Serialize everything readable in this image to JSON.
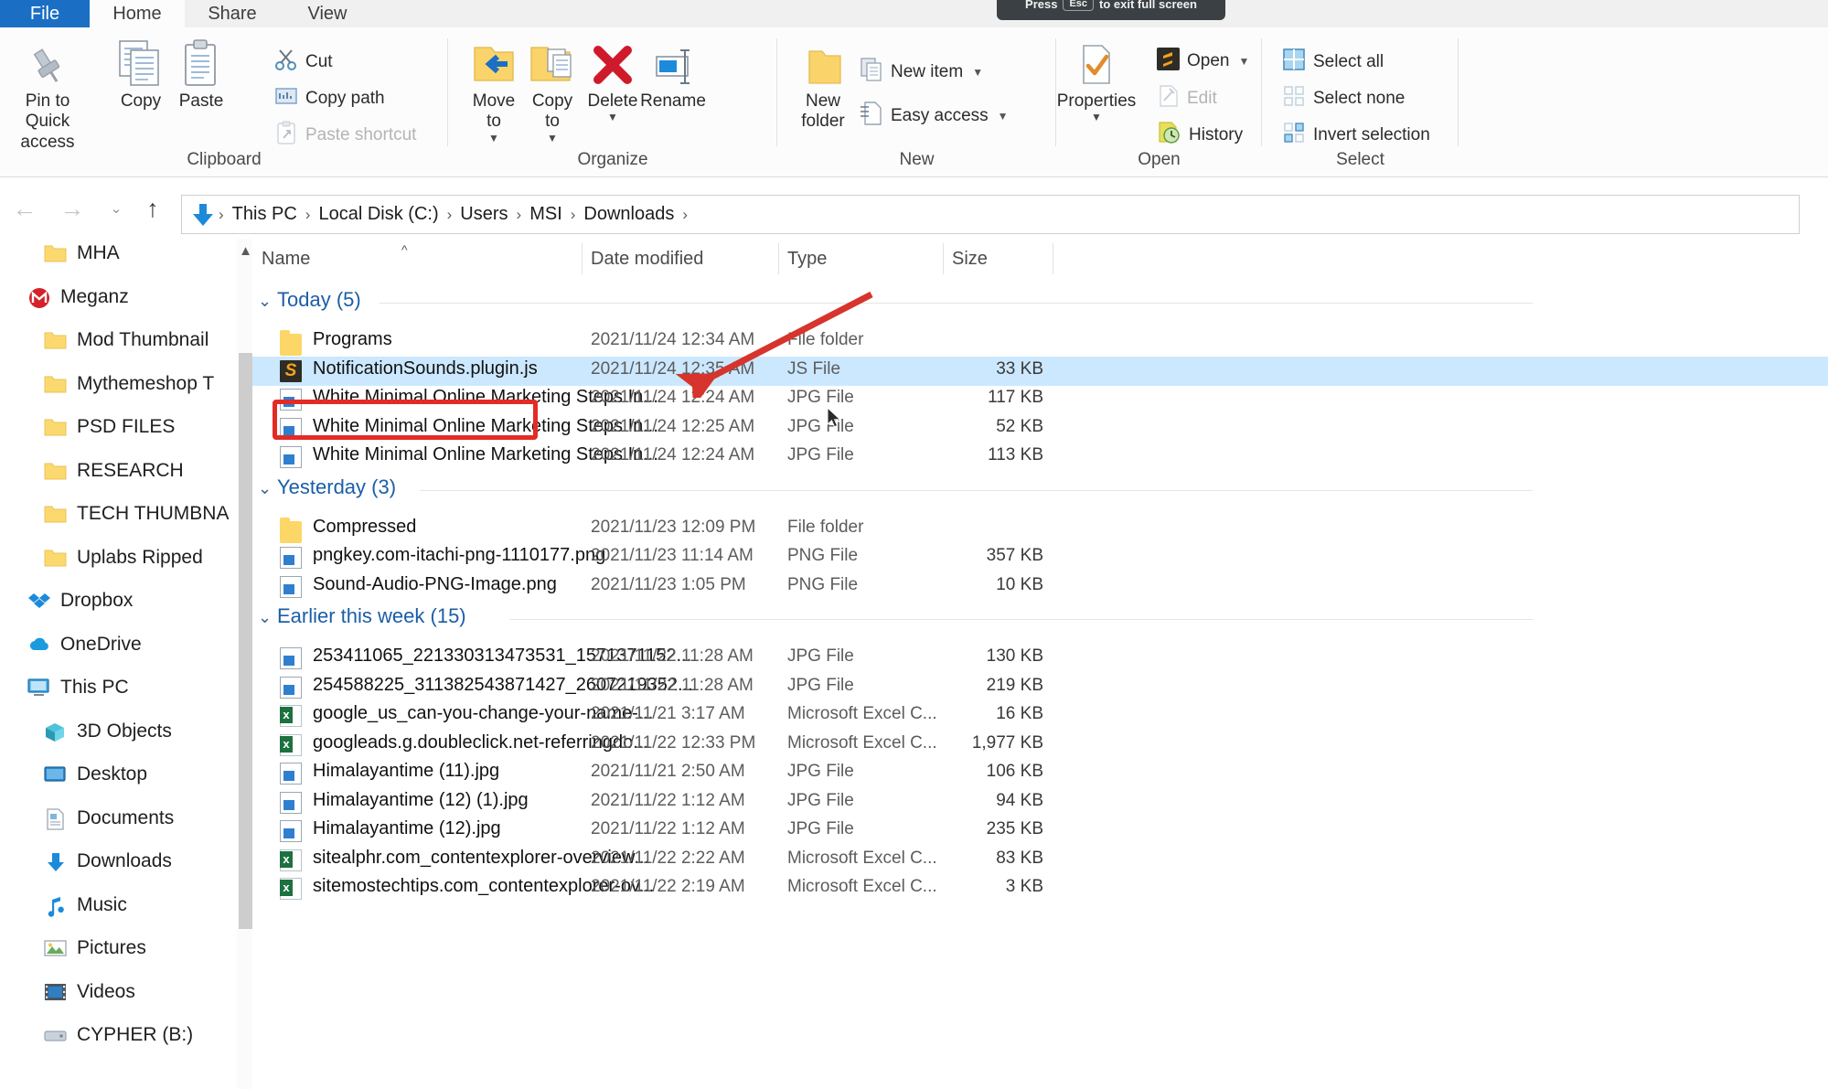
{
  "overlay": {
    "toast_prefix": "Press",
    "toast_key": "Esc",
    "toast_suffix": "to exit full screen"
  },
  "ribbon": {
    "tabs": [
      {
        "id": "file",
        "label": "File"
      },
      {
        "id": "home",
        "label": "Home"
      },
      {
        "id": "share",
        "label": "Share"
      },
      {
        "id": "view",
        "label": "View"
      }
    ],
    "groups": [
      {
        "id": "clipboard",
        "label": "Clipboard"
      },
      {
        "id": "organize",
        "label": "Organize"
      },
      {
        "id": "new",
        "label": "New"
      },
      {
        "id": "open",
        "label": "Open"
      },
      {
        "id": "select",
        "label": "Select"
      }
    ],
    "clipboard": {
      "pin_label": "Pin to Quick\naccess",
      "copy_label": "Copy",
      "paste_label": "Paste",
      "cut_label": "Cut",
      "copy_path_label": "Copy path",
      "paste_shortcut_label": "Paste shortcut"
    },
    "organize": {
      "move_to_label": "Move\nto",
      "copy_to_label": "Copy\nto",
      "delete_label": "Delete",
      "rename_label": "Rename"
    },
    "new_group": {
      "new_folder_label": "New\nfolder",
      "new_item_label": "New item",
      "easy_access_label": "Easy access"
    },
    "open_group": {
      "properties_label": "Properties",
      "open_label": "Open",
      "edit_label": "Edit",
      "history_label": "History"
    },
    "select_group": {
      "select_all_label": "Select all",
      "select_none_label": "Select none",
      "invert_selection_label": "Invert selection"
    }
  },
  "address": {
    "back_glyph": "←",
    "forward_glyph": "→",
    "history_glyph": "⌄",
    "up_glyph": "↑",
    "separator": "›",
    "crumbs": [
      "This PC",
      "Local Disk (C:)",
      "Users",
      "MSI",
      "Downloads"
    ]
  },
  "sidebar": {
    "items": [
      {
        "label": "MHA",
        "icon": "folder-icon",
        "indent": 1
      },
      {
        "label": "Meganz",
        "icon": "mega-icon",
        "indent": 0
      },
      {
        "label": "Mod Thumbnail",
        "icon": "folder-icon",
        "indent": 1
      },
      {
        "label": "Mythemeshop T",
        "icon": "folder-icon",
        "indent": 1
      },
      {
        "label": "PSD FILES",
        "icon": "folder-icon",
        "indent": 1
      },
      {
        "label": "RESEARCH",
        "icon": "folder-icon",
        "indent": 1
      },
      {
        "label": "TECH THUMBNA",
        "icon": "folder-icon",
        "indent": 1
      },
      {
        "label": "Uplabs Ripped",
        "icon": "folder-icon",
        "indent": 1
      },
      {
        "label": "Dropbox",
        "icon": "dropbox-icon",
        "indent": 0
      },
      {
        "label": "OneDrive",
        "icon": "onedrive-icon",
        "indent": 0
      },
      {
        "label": "This PC",
        "icon": "monitor-icon",
        "indent": 0
      },
      {
        "label": "3D Objects",
        "icon": "cube-icon",
        "indent": 1
      },
      {
        "label": "Desktop",
        "icon": "desktop-icon",
        "indent": 1
      },
      {
        "label": "Documents",
        "icon": "documents-icon",
        "indent": 1
      },
      {
        "label": "Downloads",
        "icon": "downloads-icon",
        "indent": 1
      },
      {
        "label": "Music",
        "icon": "music-icon",
        "indent": 1
      },
      {
        "label": "Pictures",
        "icon": "pictures-icon",
        "indent": 1
      },
      {
        "label": "Videos",
        "icon": "videos-icon",
        "indent": 1
      },
      {
        "label": "CYPHER (B:)",
        "icon": "drive-icon",
        "indent": 1
      }
    ]
  },
  "filelist": {
    "columns": [
      {
        "id": "name",
        "label": "Name"
      },
      {
        "id": "date",
        "label": "Date modified"
      },
      {
        "id": "type",
        "label": "Type"
      },
      {
        "id": "size",
        "label": "Size"
      }
    ],
    "sort_caret": "⌃",
    "group_chevron": "⌄",
    "groups": [
      {
        "title": "Today (5)",
        "rows": [
          {
            "name": "Programs",
            "date": "2021/11/24 12:34 AM",
            "type": "File folder",
            "size": "",
            "icon": "folder-icon",
            "selected": false
          },
          {
            "name": "NotificationSounds.plugin.js",
            "date": "2021/11/24 12:35 AM",
            "type": "JS File",
            "size": "33 KB",
            "icon": "js-file-icon",
            "selected": true
          },
          {
            "name": "White Minimal Online Marketing Steps In...",
            "date": "2021/11/24 12:24 AM",
            "type": "JPG File",
            "size": "117 KB",
            "icon": "image-file-icon",
            "selected": false
          },
          {
            "name": "White Minimal Online Marketing Steps In...",
            "date": "2021/11/24 12:25 AM",
            "type": "JPG File",
            "size": "52 KB",
            "icon": "image-file-icon",
            "selected": false
          },
          {
            "name": "White Minimal Online Marketing Steps In...",
            "date": "2021/11/24 12:24 AM",
            "type": "JPG File",
            "size": "113 KB",
            "icon": "image-file-icon",
            "selected": false
          }
        ]
      },
      {
        "title": "Yesterday (3)",
        "rows": [
          {
            "name": "Compressed",
            "date": "2021/11/23 12:09 PM",
            "type": "File folder",
            "size": "",
            "icon": "folder-icon",
            "selected": false
          },
          {
            "name": "pngkey.com-itachi-png-1110177.png",
            "date": "2021/11/23 11:14 AM",
            "type": "PNG File",
            "size": "357 KB",
            "icon": "image-file-icon",
            "selected": false
          },
          {
            "name": "Sound-Audio-PNG-Image.png",
            "date": "2021/11/23 1:05 PM",
            "type": "PNG File",
            "size": "10 KB",
            "icon": "image-file-icon",
            "selected": false
          }
        ]
      },
      {
        "title": "Earlier this week (15)",
        "rows": [
          {
            "name": "253411065_221330313473531_1571371152...",
            "date": "2021/11/22 11:28 AM",
            "type": "JPG File",
            "size": "130 KB",
            "icon": "image-file-icon",
            "selected": false
          },
          {
            "name": "254588225_311382543871427_2607219352...",
            "date": "2021/11/22 11:28 AM",
            "type": "JPG File",
            "size": "219 KB",
            "icon": "image-file-icon",
            "selected": false
          },
          {
            "name": "google_us_can-you-change-your-name-...",
            "date": "2021/11/21 3:17 AM",
            "type": "Microsoft Excel C...",
            "size": "16 KB",
            "icon": "excel-file-icon",
            "selected": false
          },
          {
            "name": "googleads.g.doubleclick.net-referringdo...",
            "date": "2021/11/22 12:33 PM",
            "type": "Microsoft Excel C...",
            "size": "1,977 KB",
            "icon": "excel-file-icon",
            "selected": false
          },
          {
            "name": "Himalayantime (11).jpg",
            "date": "2021/11/21 2:50 AM",
            "type": "JPG File",
            "size": "106 KB",
            "icon": "image-file-icon",
            "selected": false
          },
          {
            "name": "Himalayantime (12) (1).jpg",
            "date": "2021/11/22 1:12 AM",
            "type": "JPG File",
            "size": "94 KB",
            "icon": "image-file-icon",
            "selected": false
          },
          {
            "name": "Himalayantime (12).jpg",
            "date": "2021/11/22 1:12 AM",
            "type": "JPG File",
            "size": "235 KB",
            "icon": "image-file-icon",
            "selected": false
          },
          {
            "name": "sitealphr.com_contentexplorer-overview...",
            "date": "2021/11/22 2:22 AM",
            "type": "Microsoft Excel C...",
            "size": "83 KB",
            "icon": "excel-file-icon",
            "selected": false
          },
          {
            "name": "sitemostechtips.com_contentexplorer-ov...",
            "date": "2021/11/22 2:19 AM",
            "type": "Microsoft Excel C...",
            "size": "3 KB",
            "icon": "excel-file-icon",
            "selected": false
          }
        ]
      }
    ]
  },
  "annotations": {
    "highlight_color": "#e32b26",
    "arrow_color": "#d6342c",
    "selection_color": "#cce8ff"
  }
}
